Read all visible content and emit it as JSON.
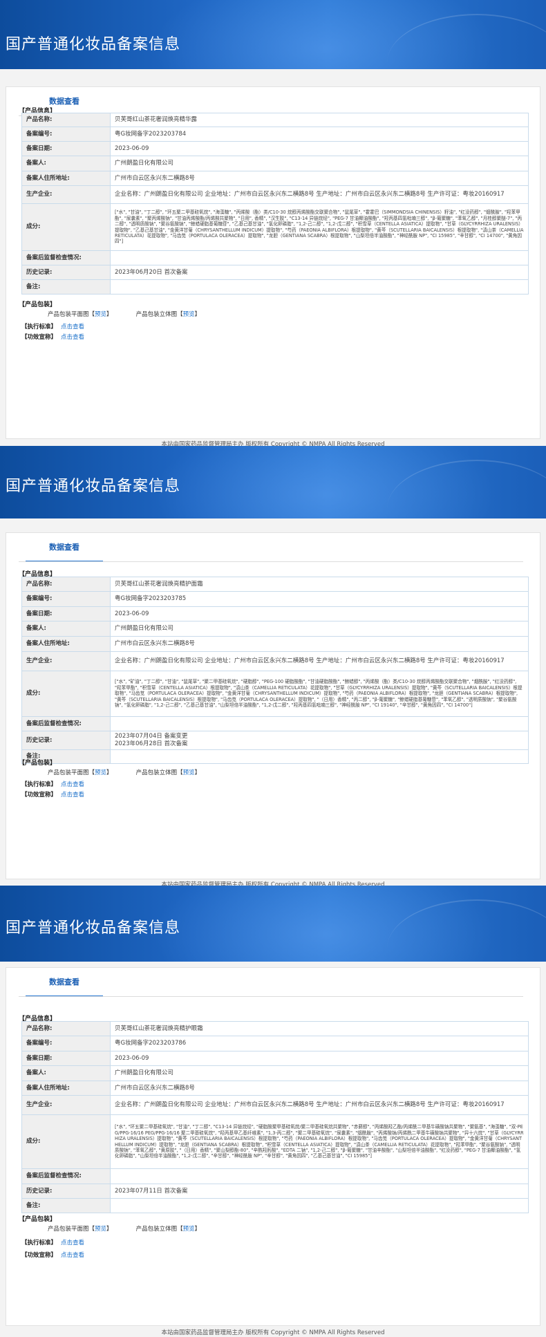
{
  "common": {
    "banner_title": "国产普通化妆品备案信息",
    "tab_label": "数据查看",
    "product_info_label": "【产品信息】",
    "keys": {
      "name": "产品名称:",
      "code": "备案编号:",
      "date": "备案日期:",
      "person": "备案人:",
      "address": "备案人住所地址:",
      "producer": "生产企业:",
      "ingredients": "成分:",
      "supervision": "备案后监督检查情况:",
      "history": "历史记录:",
      "remarks": "备注:"
    },
    "package_label": "【产品包装】",
    "flat_label": "产品包装平面图",
    "stereo_label": "产品包装立体图",
    "preview_label": "预览",
    "bracket_open": "【",
    "bracket_close": "】",
    "standard_label": "【执行标准】",
    "efficacy_label": "【功效宣称】",
    "click_label": "点击查看",
    "footer": "本站由国家药品监督管理局主办 版权所有 Copyright © NMPA All Rights Reserved"
  },
  "records": [
    {
      "name": "贝芙哥红山茶花奢润焕亮精华露",
      "code": "粤G妆网备字2023203784",
      "date": "2023-06-09",
      "person": "广州朗盈日化有限公司",
      "address": "广州市白云区永兴东二横路8号",
      "producer": "企业名称：广州朗盈日化有限公司 企业地址：广州市白云区永兴东二横路8号 生产地址：广州市白云区永兴东二横路8号 生产许可证：粤妆20160917",
      "ingredients": "[\"水\", \"甘油\", \"丁二醇\", \"环五聚二甲基硅氧烷\", \"海藻糖\", \"丙烯酸（酯）类/C10-30 烷醇丙烯酸酯交联聚合物\", \"鼠尾草\", \"霍霍巴（SIMMONDSIA CHINENSIS）籽油\", \"红没药醇\", \"烟酰胺\", \"羟苯甲酯\", \"尿囊素\", \"聚丙烯酸钠\", \"甘油丙烯酸酯/丙烯酸共聚物\", \"日用\", 香精\", \"汉生胶\", \"C13-14 异链烷烃\", \"PEG-7 甘油椰油酸酯\", \"羟丙基四氢吡喃三醇\", \"β-葡聚糖\", \"苯氧乙醇\", \"月桂醇聚醚-7\", \"丙二醇\", \"透明质酸钠\", \"聚谷氨酸钠\", \"鲸蜡硬脂基葡糖苷\", \"乙基己基甘油\", \"氢化卵磷脂\", \"1,2-己二醇\", \"1,2-戊二醇\", \"积雪草（CENTELLA ASIATICA）提取物\", \"甘草（GLYCYRRHIZA URALENSIS）提取物\", \"乙基己基甘油\", \"金黄洋甘菊（CHRYSANTHELLUM INDICUM）提取物\", \"芍药（PAEONIA ALBIFLORA）根提取物\", \"黄芩（SCUTELLARIA BAICALENSIS）根提取物\", \"滇山茶（CAMELLIA RETICULATA）花提取物\", \"马齿苋（PORTULACA OLERACEA）提取物\", \"龙胆（GENTIANA SCABRA）根提取物\", \"山梨坦倍半油酸酯\", \"神经酰胺 NP\", \"CI 15985\", \"辛甘醇\", \"CI 14700\", \"黄角因四\"]",
      "supervision": "",
      "history": [
        "2023年06月20日 首次备案"
      ],
      "remarks": ""
    },
    {
      "name": "贝芙哥红山茶花奢润焕亮精护面霜",
      "code": "粤G妆网备字2023203785",
      "date": "2023-06-09",
      "person": "广州朗盈日化有限公司",
      "address": "广州市白云区永兴东二横路8号",
      "producer": "企业名称：广州朗盈日化有限公司 企业地址：广州市白云区永兴东二横路8号 生产地址：广州市白云区永兴东二横路8号 生产许可证：粤妆20160917",
      "ingredients": "[\"水\", \"矿油\", \"丁二醇\", \"甘油\", \"鼠尾草\", \"聚二甲基硅氧烷\", \"硬脂醇\", \"PEG-100 硬脂酸酯\", \"甘油硬脂酸酯\", \"鲸蜡醇\", \"丙烯酸（酯）类/C10-30 烷醇丙烯酸酯交联聚合物\", \"烟酰胺\", \"红没药醇\", \"羟苯甲酯\", \"积雪草（CENTELLA ASIATICA）根提取物\", \"滇山茶（CAMELLIA RETICULATA）花提取物\", \"甘草（GLYCYRRHIZA URALENSIS）提取物\", \"黄芩（SCUTELLARIA BAICALENSIS）根提取物\", \"马齿苋（PORTULACA OLERACEA）提取物\", \"金黄洋甘菊（CHRYSANTHELLUM INDICUM）提取物\", \"芍药（PAEONIA ALBIFLORA）根提取物\", \"龙胆（GENTIANA SCABRA）根提取物\", \"黄芩（SCUTELLARIA BAICALENSIS）根提取物\", \"马齿苋（PORTULACA OLERACEA）提取物\", \"（日用）香精\", \"丙二醇\", \"β-葡聚糖\", \"鲸蜡硬脂基葡糖苷\", \"苯氧乙醇\", \"透明质酸钠\", \"聚谷氨酸钠\", \"氢化卵磷脂\", \"1,2-己二醇\", \"乙基己基甘油\", \"山梨坦倍半油酸酯\", \"1,2-戊二醇\", \"羟丙基四氢吡喃三醇\", \"神经酰胺 NP\", \"CI 19140\", \"辛甘醇\", \"黄角因四\", \"CI 14700\"]",
      "supervision": "",
      "history": [
        "2023年07月04日 备案变更",
        "2023年06月28日 首次备案"
      ],
      "remarks": ""
    },
    {
      "name": "贝芙哥红山茶花奢润焕亮精护眼霜",
      "code": "粤G妆网备字2023203786",
      "date": "2023-06-09",
      "person": "广州朗盈日化有限公司",
      "address": "广州市白云区永兴东二横路8号",
      "producer": "企业名称：广州朗盈日化有限公司 企业地址：广州市白云区永兴东二横路8号 生产地址：广州市白云区永兴东二横路8号 生产许可证：粤妆20160917",
      "ingredients": "[\"水\", \"环五聚二甲基硅氧烷\", \"甘油\", \"丁二醇\", \"C13-14 异链烷烃\", \"硬脂酸聚甲基硅氧烷/聚二甲基硅氧烷共聚物\", \"赤藓醇\", \"丙烯酸羟乙酯/丙烯酰二甲基牛磺酸钠共聚物\", \"聚氨基\", \"海藻糖\", \"双-PEG/PPG-16/16 PEG/PPG-16/16 聚二甲基硅氧烷\", \"羟丙基甲乙基纤维素\", \"1,3-丙二醇\", \"聚二甲基硅氧烷\", \"尿囊素\", \"烟酰胺\", \"丙烯酸钠/丙烯酰二甲基牛磺酸钠共聚物\", \"异十六烷\", \"甘草（GLYCYRRHIZA URALENSIS）提取物\", \"黄芩（SCUTELLARIA BAICALENSIS）根提取物\", \"芍药（PAEONIA ALBIFLORA）根提取物\", \"马齿苋（PORTULACA OLERACEA）提取物\", \"金黄洋甘菊（CHRYSANTHELLUM INDICUM）提取物\", \"龙胆（GENTIANA SCABRA）根提取物\", \"积雪草（CENTELLA ASIATICA）提取物\", \"滇山茶（CAMELLIA RETICULATA）花提取物\", \"羟苯甲酯\", \"聚谷氨酸钠\", \"透明质酸钠\", \"苯氧乙醇\", \"黄原胶\", \"（日用）香精\", \"聚山梨醇酯-80\", \"辛酰羟肟酸\", \"EDTA 二钠\", \"1,2-己二醇\", \"β-葡聚糖\", \"甘油辛酸酯\", \"山梨坦倍半油酸酯\", \"红没药醇\", \"PEG-7 甘油椰油酸酯\", \"氢化卵磷脂\", \"山梨坦倍半油酸酯\", \"1,2-戊二醇\", \"辛甘醇\", \"神经酰胺 NP\", \"辛甘醇\", \"黄角因四\", \"乙基己基甘油\", \"CI 15985\"]",
      "supervision": "",
      "history": [
        "2023年07月11日 首次备案"
      ],
      "remarks": ""
    }
  ]
}
